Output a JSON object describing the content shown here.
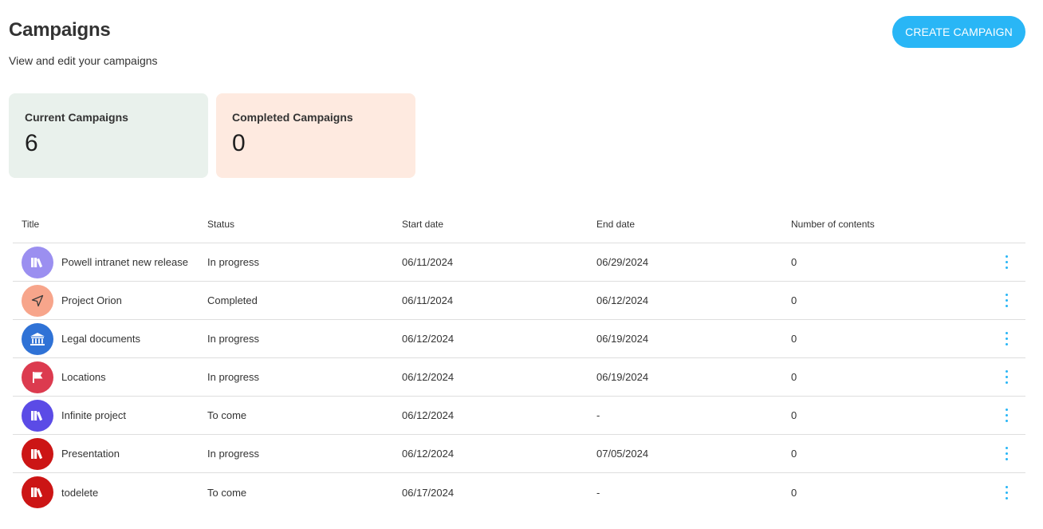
{
  "header": {
    "title": "Campaigns",
    "subtitle": "View and edit your campaigns",
    "create_label": "CREATE CAMPAIGN"
  },
  "stats": {
    "current": {
      "label": "Current Campaigns",
      "value": "6"
    },
    "completed": {
      "label": "Completed Campaigns",
      "value": "0"
    }
  },
  "table": {
    "columns": [
      "Title",
      "Status",
      "Start date",
      "End date",
      "Number of contents"
    ],
    "rows": [
      {
        "title": "Powell intranet new release",
        "status": "In progress",
        "start": "06/11/2024",
        "end": "06/29/2024",
        "count": "0",
        "icon": "books-icon",
        "color": "#9b8ff0"
      },
      {
        "title": "Project Orion",
        "status": "Completed",
        "start": "06/11/2024",
        "end": "06/12/2024",
        "count": "0",
        "icon": "navigation-arrow-icon",
        "color": "#f7a58b"
      },
      {
        "title": "Legal documents",
        "status": "In progress",
        "start": "06/12/2024",
        "end": "06/19/2024",
        "count": "0",
        "icon": "bank-icon",
        "color": "#2f72d6"
      },
      {
        "title": "Locations",
        "status": "In progress",
        "start": "06/12/2024",
        "end": "06/19/2024",
        "count": "0",
        "icon": "flag-icon",
        "color": "#dc3b4f"
      },
      {
        "title": "Infinite project",
        "status": "To come",
        "start": "06/12/2024",
        "end": "-",
        "count": "0",
        "icon": "books-icon",
        "color": "#5b4be6"
      },
      {
        "title": "Presentation",
        "status": "In progress",
        "start": "06/12/2024",
        "end": "07/05/2024",
        "count": "0",
        "icon": "books-icon",
        "color": "#cc1515"
      },
      {
        "title": "todelete",
        "status": "To come",
        "start": "06/17/2024",
        "end": "-",
        "count": "0",
        "icon": "books-icon",
        "color": "#cc1515"
      }
    ]
  },
  "colors": {
    "accent": "#29b6f6",
    "current_card_bg": "#e9f1ec",
    "completed_card_bg": "#feeae0"
  }
}
